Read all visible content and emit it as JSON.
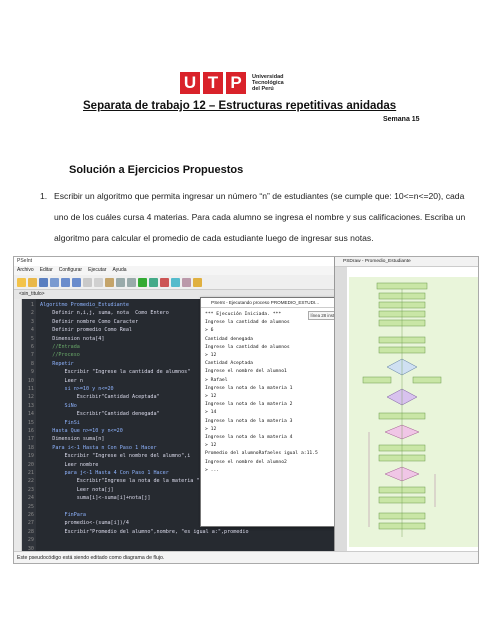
{
  "logo": {
    "letters": [
      "U",
      "T",
      "P"
    ],
    "text": "Universidad\nTecnológica\ndel Perú"
  },
  "document": {
    "title": "Separata de trabajo 12 – Estructuras repetitivas anidadas",
    "week": "Semana 15",
    "section_heading": "Solución a Ejercicios Propuestos",
    "exercise_number": "1.",
    "exercise_text": "Escribir un algoritmo que permita ingresar un número “n” de estudiantes (se cumple que: 10<=n<=20), cada uno de los cuáles cursa 4 materias.  Para cada alumno se ingresa el nombre y sus calificaciones. Escriba un algoritmo para calcular el promedio de cada estudiante luego de ingresar sus notas."
  },
  "ide": {
    "window_title": "PSeInt",
    "menu": [
      "Archivo",
      "Editar",
      "Configurar",
      "Ejecutar",
      "Ayuda"
    ],
    "tab": "<sin_titulo>",
    "status": "Este pseudocódigo está siendo editado como diagrama de flujo."
  },
  "code_lines": [
    {
      "n": "1",
      "text": "Algoritmo Promedio_Estudiante",
      "cls": "kw"
    },
    {
      "n": "2",
      "text": "    Definir n,i,j, suma, nota  Como Entero",
      "cls": ""
    },
    {
      "n": "3",
      "text": "    Definir nombre Como Caracter",
      "cls": ""
    },
    {
      "n": "4",
      "text": "    Definir promedio Como Real",
      "cls": ""
    },
    {
      "n": "5",
      "text": "    Dimension nota[4]",
      "cls": ""
    },
    {
      "n": "6",
      "text": "    //Entrada",
      "cls": "cm"
    },
    {
      "n": "7",
      "text": "    //Proceso",
      "cls": "cm"
    },
    {
      "n": "8",
      "text": "    Repetir",
      "cls": "kw"
    },
    {
      "n": "9",
      "text": "        Escribir \"Ingrese la cantidad de alumnos\"",
      "cls": ""
    },
    {
      "n": "10",
      "text": "        Leer n",
      "cls": ""
    },
    {
      "n": "11",
      "text": "        si n>=10 y n<=20",
      "cls": "kw"
    },
    {
      "n": "12",
      "text": "            Escribir\"Cantidad Aceptada\"",
      "cls": ""
    },
    {
      "n": "13",
      "text": "        SiNo",
      "cls": "kw"
    },
    {
      "n": "14",
      "text": "            Escribir\"Cantidad denegada\"",
      "cls": ""
    },
    {
      "n": "15",
      "text": "        FinSi",
      "cls": "kw"
    },
    {
      "n": "16",
      "text": "    Hasta Que n>=10 y n<=20",
      "cls": "kw"
    },
    {
      "n": "17",
      "text": "    Dimension suma[n]",
      "cls": ""
    },
    {
      "n": "18",
      "text": "    Para i<-1 Hasta n Con Paso 1 Hacer",
      "cls": "kw"
    },
    {
      "n": "19",
      "text": "        Escribir \"Ingrese el nombre del alumno\",i",
      "cls": ""
    },
    {
      "n": "20",
      "text": "        Leer nombre",
      "cls": ""
    },
    {
      "n": "21",
      "text": "        para j<-1 Hasta 4 Con Paso 1 Hacer",
      "cls": "kw"
    },
    {
      "n": "22",
      "text": "            Escribir\"Ingrese la nota de la materia \",j",
      "cls": ""
    },
    {
      "n": "23",
      "text": "            Leer nota[j]",
      "cls": ""
    },
    {
      "n": "24",
      "text": "            suma[i]<-suma[i]+nota[j]",
      "cls": ""
    },
    {
      "n": "25",
      "text": "",
      "cls": ""
    },
    {
      "n": "26",
      "text": "        FinPara",
      "cls": "kw"
    },
    {
      "n": "27",
      "text": "        promedio<-(suma[i])/4",
      "cls": ""
    },
    {
      "n": "28",
      "text": "        Escribir\"Promedio del alumno\",nombre, \"es igual a:\",promedio",
      "cls": ""
    },
    {
      "n": "29",
      "text": "",
      "cls": ""
    },
    {
      "n": "30",
      "text": "",
      "cls": ""
    }
  ],
  "console": {
    "title": "PSeInt - Ejecutando proceso PROMEDIO_ESTUDI...",
    "badge": "línea 28 instrucción 1",
    "lines": [
      "*** Ejecución Iniciada. ***",
      "Ingrese la cantidad de alumnos",
      "> 6",
      "Cantidad denegada",
      "Ingrese la cantidad de alumnos",
      "> 12",
      "Cantidad Aceptada",
      "Ingrese el nombre del alumno1",
      "> Rafael",
      "Ingrese la nota de la materia 1",
      "> 12",
      "Ingrese la nota de la materia 2",
      "> 14",
      "Ingrese la nota de la materia 3",
      "> 12",
      "Ingrese la nota de la materia 4",
      "> 12",
      "Promedio del alumnoRafaeles igual a:11.5",
      "Ingrese el nombre del alumno2",
      "> ..."
    ]
  },
  "flowchart": {
    "title": "PSDraw - Promedio_Estudiante"
  },
  "colors": {
    "utp_red": "#d9222a",
    "editor_bg": "#262a30",
    "flow_bg": "#e9f5da"
  }
}
